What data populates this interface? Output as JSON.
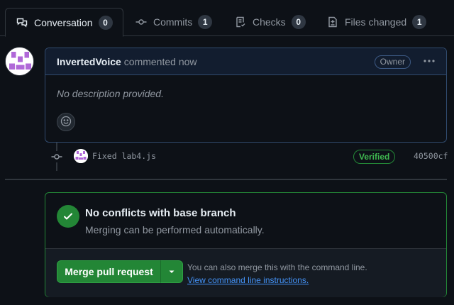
{
  "tabs": [
    {
      "label": "Conversation",
      "count": "0",
      "icon": "comment-discussion-icon",
      "active": true
    },
    {
      "label": "Commits",
      "count": "1",
      "icon": "git-commit-icon",
      "active": false
    },
    {
      "label": "Checks",
      "count": "0",
      "icon": "checklist-icon",
      "active": false
    },
    {
      "label": "Files changed",
      "count": "1",
      "icon": "file-diff-icon",
      "active": false
    }
  ],
  "comment": {
    "author": "InvertedVoice",
    "action": "commented now",
    "role_badge": "Owner",
    "body": "No description provided.",
    "more_icon": "kebab-horizontal-icon",
    "reaction_icon": "smiley-icon"
  },
  "commit": {
    "message": "Fixed lab4.js",
    "status": "Verified",
    "sha": "40500cf"
  },
  "merge": {
    "title": "No conflicts with base branch",
    "subtitle": "Merging can be performed automatically.",
    "button_label": "Merge pull request",
    "cli_text": "You can also merge this with the command line.",
    "cli_link": "View command line instructions."
  },
  "colors": {
    "accent_green": "#238636",
    "link_blue": "#4493f8",
    "avatar_purple": "#b068d8"
  }
}
